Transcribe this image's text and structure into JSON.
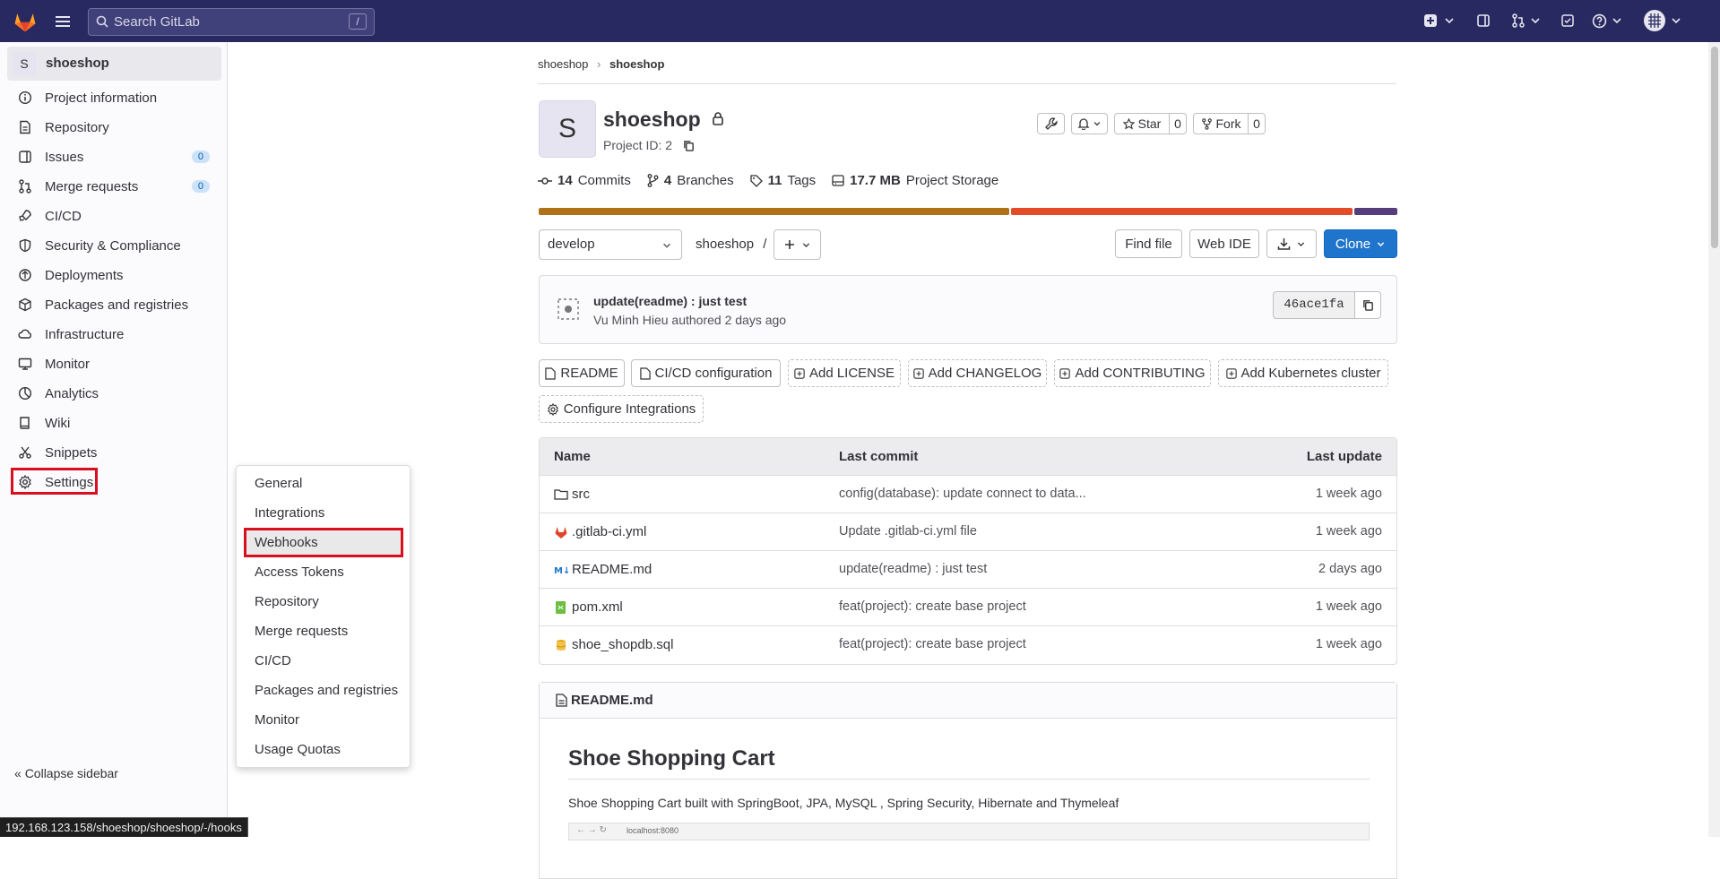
{
  "topbar": {
    "search_placeholder": "Search GitLab",
    "search_shortcut": "/"
  },
  "sidebar": {
    "project_avatar": "S",
    "project_name": "shoeshop",
    "items": [
      {
        "label": "Project information",
        "icon": "info-icon"
      },
      {
        "label": "Repository",
        "icon": "doc-icon"
      },
      {
        "label": "Issues",
        "icon": "issues-icon",
        "count": "0"
      },
      {
        "label": "Merge requests",
        "icon": "merge-request-icon",
        "count": "0"
      },
      {
        "label": "CI/CD",
        "icon": "rocket-icon"
      },
      {
        "label": "Security & Compliance",
        "icon": "shield-icon"
      },
      {
        "label": "Deployments",
        "icon": "deployments-icon"
      },
      {
        "label": "Packages and registries",
        "icon": "package-icon"
      },
      {
        "label": "Infrastructure",
        "icon": "cloud-icon"
      },
      {
        "label": "Monitor",
        "icon": "monitor-icon"
      },
      {
        "label": "Analytics",
        "icon": "chart-icon"
      },
      {
        "label": "Wiki",
        "icon": "book-icon"
      },
      {
        "label": "Snippets",
        "icon": "scissors-icon"
      },
      {
        "label": "Settings",
        "icon": "gear-icon"
      }
    ],
    "collapse_label": "Collapse sidebar"
  },
  "settings_flyout": [
    "General",
    "Integrations",
    "Webhooks",
    "Access Tokens",
    "Repository",
    "Merge requests",
    "CI/CD",
    "Packages and registries",
    "Monitor",
    "Usage Quotas"
  ],
  "statusbar": "192.168.123.158/shoeshop/shoeshop/-/hooks",
  "breadcrumb": {
    "first": "shoeshop",
    "second": "shoeshop"
  },
  "project": {
    "avatar": "S",
    "title": "shoeshop",
    "project_id": "Project ID: 2",
    "star_label": "Star",
    "star_count": "0",
    "fork_label": "Fork",
    "fork_count": "0"
  },
  "stats": {
    "commits_num": "14",
    "commits_label": "Commits",
    "branches_num": "4",
    "branches_label": "Branches",
    "tags_num": "11",
    "tags_label": "Tags",
    "storage_num": "17.7 MB",
    "storage_label": "Project Storage"
  },
  "language_bar": [
    {
      "color": "#b07219",
      "share": 0.55
    },
    {
      "color": "#e34c26",
      "share": 0.4
    },
    {
      "color": "#563d7c",
      "share": 0.05
    }
  ],
  "toolbar": {
    "branch": "develop",
    "path": "shoeshop",
    "path_sep": "/",
    "find_file": "Find file",
    "web_ide": "Web IDE",
    "clone": "Clone"
  },
  "last_commit": {
    "title": "update(readme) : just test",
    "author": "Vu Minh Hieu",
    "when": "authored 2 days ago",
    "sha": "46ace1fa"
  },
  "quick_buttons": [
    "README",
    "CI/CD configuration",
    "Add LICENSE",
    "Add CHANGELOG",
    "Add CONTRIBUTING",
    "Add Kubernetes cluster",
    "Configure Integrations"
  ],
  "files": {
    "headers": {
      "name": "Name",
      "commit": "Last commit",
      "update": "Last update"
    },
    "rows": [
      {
        "name": "src",
        "commit": "config(database): update connect to data...",
        "update": "1 week ago",
        "icon": "folder-icon"
      },
      {
        "name": ".gitlab-ci.yml",
        "commit": "Update .gitlab-ci.yml file",
        "update": "1 week ago",
        "icon": "gitlab-file-icon"
      },
      {
        "name": "README.md",
        "commit": "update(readme) : just test",
        "update": "2 days ago",
        "icon": "markdown-icon"
      },
      {
        "name": "pom.xml",
        "commit": "feat(project): create base project",
        "update": "1 week ago",
        "icon": "xml-file-icon"
      },
      {
        "name": "shoe_shopdb.sql",
        "commit": "feat(project): create base project",
        "update": "1 week ago",
        "icon": "database-icon"
      }
    ]
  },
  "readme": {
    "file": "README.md",
    "heading": "Shoe Shopping Cart",
    "paragraph": "Shoe Shopping Cart built with SpringBoot, JPA, MySQL , Spring Security, Hibernate and Thymeleaf",
    "embedded_url": "localhost:8080"
  }
}
